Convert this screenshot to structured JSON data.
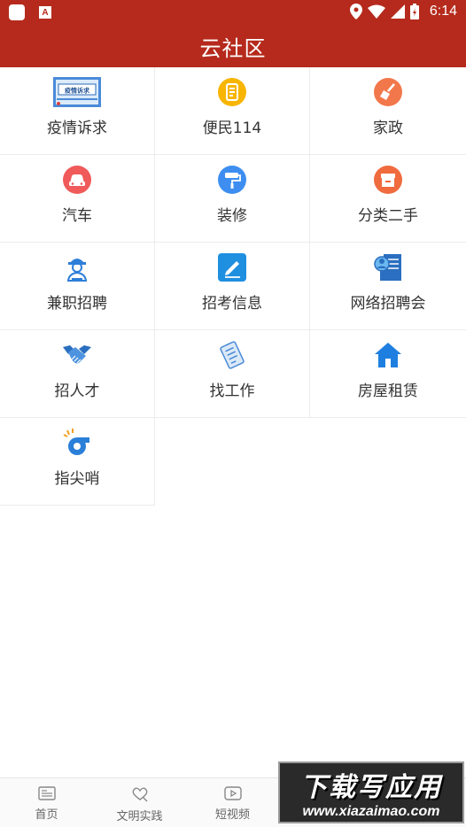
{
  "status_bar": {
    "time": "6:14",
    "left_icons": [
      "app-notification-icon",
      "a-badge-icon"
    ],
    "right_icons": [
      "location-icon",
      "wifi-icon",
      "signal-icon",
      "battery-icon"
    ]
  },
  "header": {
    "title": "云社区",
    "bg_color": "#b52a1c"
  },
  "grid": {
    "items": [
      {
        "label": "疫情诉求",
        "icon": "epidemic-appeal-banner-icon"
      },
      {
        "label": "便民114",
        "icon": "phone-book-icon"
      },
      {
        "label": "家政",
        "icon": "broom-icon"
      },
      {
        "label": "汽车",
        "icon": "car-icon"
      },
      {
        "label": "装修",
        "icon": "paint-roller-icon"
      },
      {
        "label": "分类二手",
        "icon": "box-icon"
      },
      {
        "label": "兼职招聘",
        "icon": "worker-icon"
      },
      {
        "label": "招考信息",
        "icon": "pen-edit-icon"
      },
      {
        "label": "网络招聘会",
        "icon": "resume-person-icon"
      },
      {
        "label": "招人才",
        "icon": "handshake-icon"
      },
      {
        "label": "找工作",
        "icon": "document-list-icon"
      },
      {
        "label": "房屋租赁",
        "icon": "house-icon"
      },
      {
        "label": "指尖哨",
        "icon": "whistle-icon"
      }
    ],
    "banner_text": "疫情诉求"
  },
  "bottom_nav": {
    "items": [
      {
        "label": "首页",
        "icon": "home-news-icon"
      },
      {
        "label": "文明实践",
        "icon": "heart-hands-icon"
      },
      {
        "label": "短视频",
        "icon": "play-video-icon"
      }
    ]
  },
  "watermark": {
    "top": "下载写应用",
    "bottom": "www.xiazaimao.com"
  }
}
